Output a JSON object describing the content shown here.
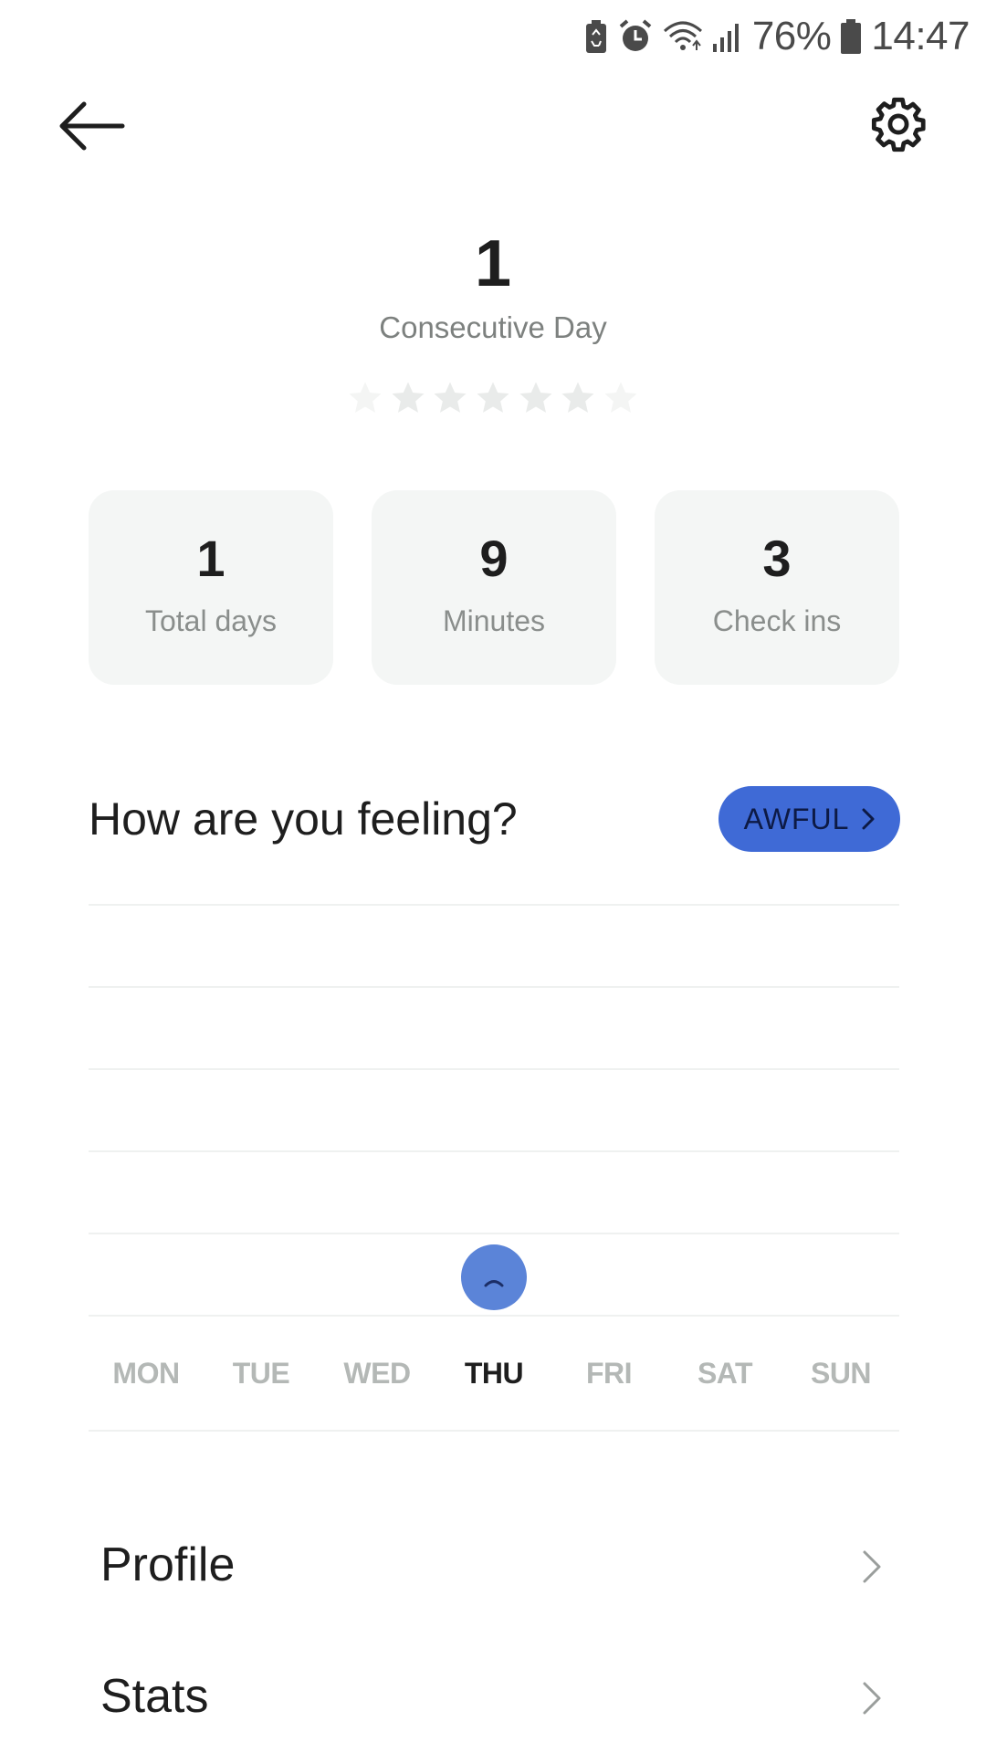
{
  "status_bar": {
    "battery_percent": "76%",
    "time": "14:47"
  },
  "streak": {
    "value": "1",
    "label": "Consecutive Day",
    "stars_total": 7
  },
  "stats": [
    {
      "value": "1",
      "label": "Total days"
    },
    {
      "value": "9",
      "label": "Minutes"
    },
    {
      "value": "3",
      "label": "Check ins"
    }
  ],
  "feeling": {
    "title": "How are you feeling?",
    "mood_button": "AWFUL"
  },
  "mood_chart": {
    "days": [
      "MON",
      "TUE",
      "WED",
      "THU",
      "FRI",
      "SAT",
      "SUN"
    ],
    "active_day": "THU",
    "entries": [
      {
        "day": "THU",
        "mood": "awful"
      }
    ]
  },
  "menu": {
    "items": [
      {
        "label": "Profile"
      },
      {
        "label": "Stats"
      }
    ]
  },
  "colors": {
    "accent": "#3f6ad6",
    "mood_dot": "#5b84d8",
    "card_bg": "#f4f6f5",
    "muted_text": "#7d817f"
  },
  "icons": {
    "back": "arrow-left-icon",
    "settings": "gear-icon",
    "chevron": "chevron-right-icon"
  }
}
